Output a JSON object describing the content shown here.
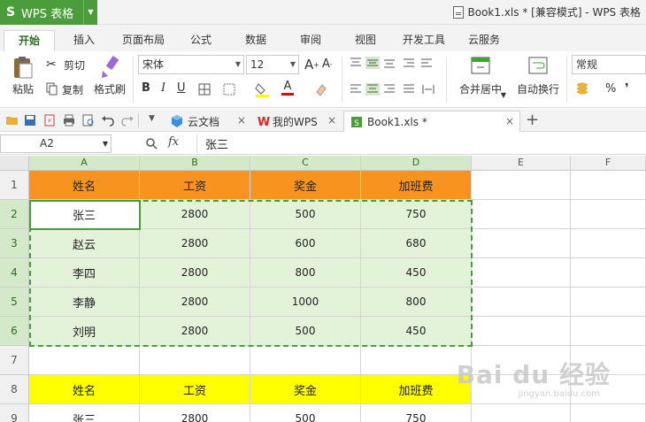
{
  "app": {
    "name": "WPS 表格",
    "logo": "S"
  },
  "window": {
    "title": "Book1.xls * [兼容模式] - WPS 表格"
  },
  "ribbon_tabs": [
    "开始",
    "插入",
    "页面布局",
    "公式",
    "数据",
    "审阅",
    "视图",
    "开发工具",
    "云服务"
  ],
  "ribbon": {
    "cut": "剪切",
    "paste": "粘贴",
    "copy": "复制",
    "format_painter": "格式刷",
    "font_name": "宋体",
    "font_size": "12",
    "bold": "B",
    "italic": "I",
    "underline": "U",
    "merge_center": "合并居中",
    "wrap_text": "自动换行",
    "number_format": "常规",
    "percent": "%",
    "comma": "❜"
  },
  "doc_tabs": [
    {
      "label": "云文档"
    },
    {
      "label": "我的WPS"
    },
    {
      "label": "Book1.xls *"
    }
  ],
  "formula_bar": {
    "cell_ref": "A2",
    "fx": "fx",
    "value": "张三"
  },
  "grid": {
    "columns": [
      "A",
      "B",
      "C",
      "D",
      "E",
      "F"
    ],
    "rows": [
      "1",
      "2",
      "3",
      "4",
      "5",
      "6",
      "7",
      "8",
      "9"
    ],
    "table1": {
      "header": [
        "姓名",
        "工资",
        "奖金",
        "加班费"
      ],
      "rows": [
        [
          "张三",
          "2800",
          "500",
          "750"
        ],
        [
          "赵云",
          "2800",
          "600",
          "680"
        ],
        [
          "李四",
          "2800",
          "800",
          "450"
        ],
        [
          "李静",
          "2800",
          "1000",
          "800"
        ],
        [
          "刘明",
          "2800",
          "500",
          "450"
        ]
      ]
    },
    "table2": {
      "header": [
        "姓名",
        "工资",
        "奖金",
        "加班费"
      ],
      "rows": [
        [
          "张三",
          "2800",
          "500",
          "750"
        ]
      ]
    }
  },
  "colors": {
    "accent": "#4a9d3a",
    "header1": "#f7931e",
    "header2": "#ffff00",
    "selection": "#e3f3da"
  },
  "watermark": {
    "main": "Bai du 经验",
    "sub": "jingyan.baidu.com"
  }
}
